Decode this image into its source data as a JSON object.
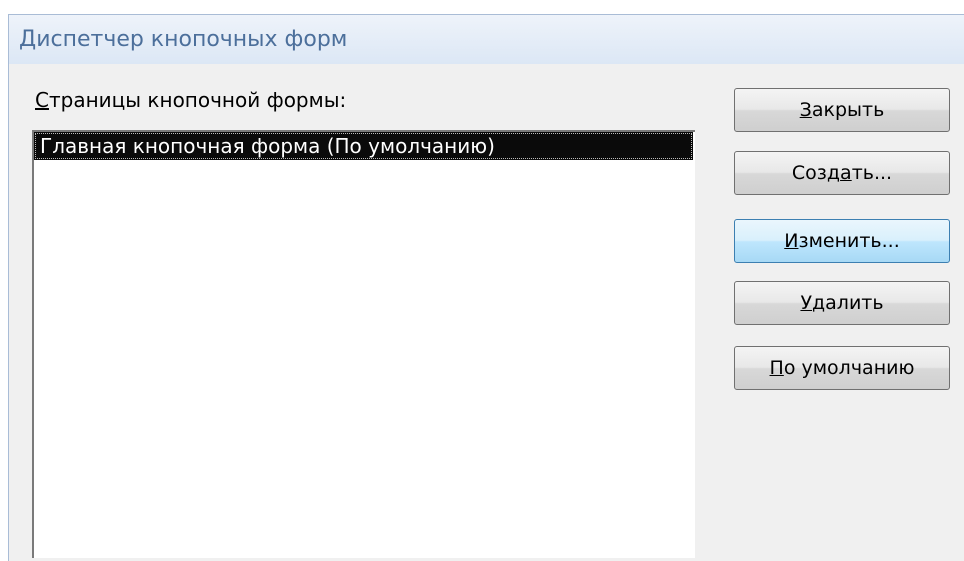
{
  "window": {
    "title": "Диспетчер кнопочных форм"
  },
  "list": {
    "label_mnemonic": "С",
    "label_rest": "траницы кнопочной формы:",
    "items": [
      {
        "label": "Главная кнопочная форма (По умолчанию)",
        "selected": true
      }
    ]
  },
  "buttons": {
    "close": {
      "pre": "",
      "mnemonic": "З",
      "post": "акрыть"
    },
    "create": {
      "pre": "Созд",
      "mnemonic": "а",
      "post": "ть..."
    },
    "edit": {
      "pre": "",
      "mnemonic": "И",
      "post": "зменить..."
    },
    "delete": {
      "pre": "",
      "mnemonic": "У",
      "post": "далить"
    },
    "default": {
      "pre": "",
      "mnemonic": "П",
      "post": "о умолчанию"
    }
  },
  "colors": {
    "title_text": "#4c6f9b",
    "selection_bg": "#0a0a0a",
    "hover_button": "#bee6fd"
  }
}
